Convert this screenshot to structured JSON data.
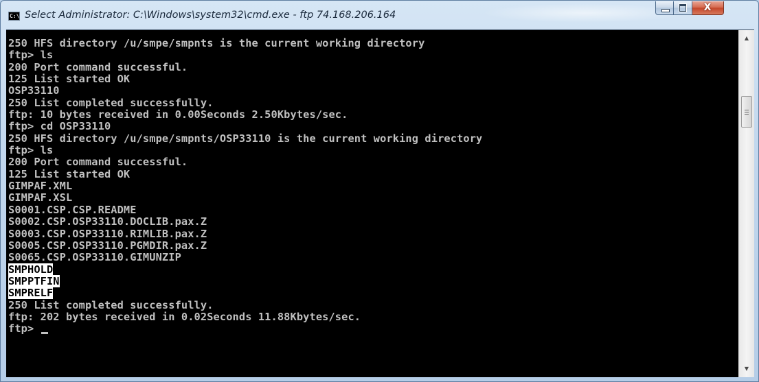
{
  "window": {
    "title": "Select Administrator: C:\\Windows\\system32\\cmd.exe - ftp  74.168.206.164",
    "icon": "cmd-icon",
    "icon_text": "C:\\",
    "controls": {
      "minimize": "minimize-icon",
      "maximize": "maximize-icon",
      "close_label": "X"
    }
  },
  "console": {
    "lines": [
      "250 HFS directory /u/smpe/smpnts is the current working directory",
      "ftp> ls",
      "200 Port command successful.",
      "125 List started OK",
      "OSP33110",
      "250 List completed successfully.",
      "ftp: 10 bytes received in 0.00Seconds 2.50Kbytes/sec.",
      "ftp> cd OSP33110",
      "250 HFS directory /u/smpe/smpnts/OSP33110 is the current working directory",
      "ftp> ls",
      "200 Port command successful.",
      "125 List started OK",
      "GIMPAF.XML",
      "GIMPAF.XSL",
      "S0001.CSP.CSP.README",
      "S0002.CSP.OSP33110.DOCLIB.pax.Z",
      "S0003.CSP.OSP33110.RIMLIB.pax.Z",
      "S0005.CSP.OSP33110.PGMDIR.pax.Z",
      "S0065.CSP.OSP33110.GIMUNZIP",
      "SMPHOLD",
      "SMPPTFIN",
      "SMPRELF",
      "250 List completed successfully.",
      "ftp: 202 bytes received in 0.02Seconds 11.88Kbytes/sec.",
      "ftp> "
    ],
    "selected_lines": [
      19,
      20,
      21
    ],
    "colors": {
      "background": "#000000",
      "foreground": "#c0c0c0",
      "selection_bg": "#ffffff",
      "selection_fg": "#000000"
    }
  },
  "scrollbar": {
    "up_icon": "scroll-up-arrow-icon",
    "down_icon": "scroll-down-arrow-icon",
    "up_glyph": "▲",
    "down_glyph": "▼"
  }
}
